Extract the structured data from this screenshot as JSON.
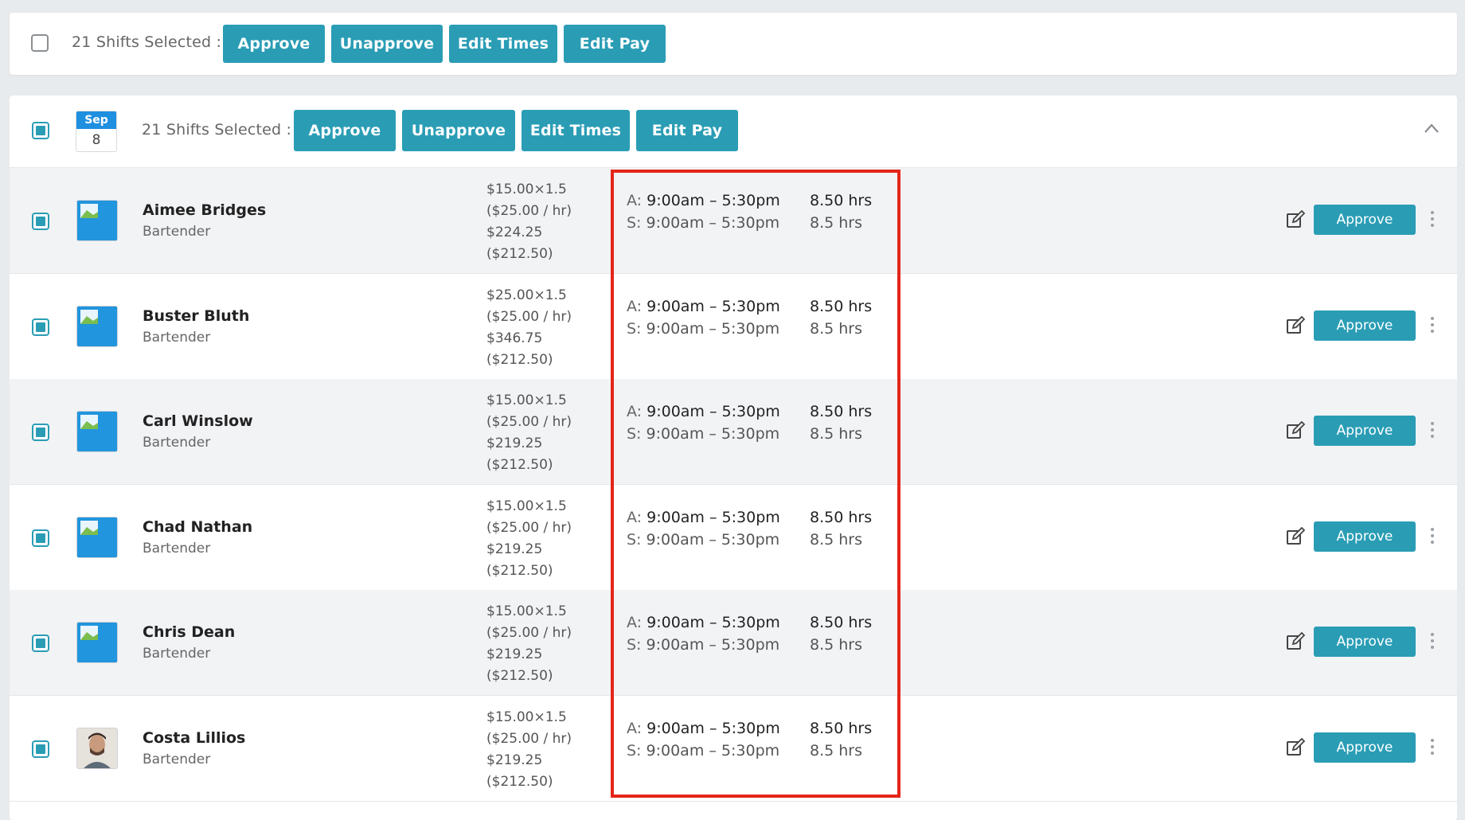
{
  "toolbar": {
    "selected_text": "21 Shifts Selected :",
    "approve": "Approve",
    "unapprove": "Unapprove",
    "edit_times": "Edit Times",
    "edit_pay": "Edit Pay"
  },
  "day_group": {
    "month": "Sep",
    "day": "8",
    "selected_text": "21 Shifts Selected :",
    "approve": "Approve",
    "unapprove": "Unapprove",
    "edit_times": "Edit Times",
    "edit_pay": "Edit Pay"
  },
  "shifts": [
    {
      "name": "Aimee Bridges",
      "role": "Bartender",
      "rate": "$15.00×1.5",
      "hourly": "($25.00 / hr)",
      "total": "$224.25",
      "base": "($212.50)",
      "a_label": "A:",
      "a_time": "9:00am – 5:30pm",
      "a_hrs": "8.50 hrs",
      "s_label": "S:",
      "s_time": "9:00am – 5:30pm",
      "s_hrs": "8.5 hrs",
      "approve": "Approve"
    },
    {
      "name": "Buster Bluth",
      "role": "Bartender",
      "rate": "$25.00×1.5",
      "hourly": "($25.00 / hr)",
      "total": "$346.75",
      "base": "($212.50)",
      "a_label": "A:",
      "a_time": "9:00am – 5:30pm",
      "a_hrs": "8.50 hrs",
      "s_label": "S:",
      "s_time": "9:00am – 5:30pm",
      "s_hrs": "8.5 hrs",
      "approve": "Approve"
    },
    {
      "name": "Carl Winslow",
      "role": "Bartender",
      "rate": "$15.00×1.5",
      "hourly": "($25.00 / hr)",
      "total": "$219.25",
      "base": "($212.50)",
      "a_label": "A:",
      "a_time": "9:00am – 5:30pm",
      "a_hrs": "8.50 hrs",
      "s_label": "S:",
      "s_time": "9:00am – 5:30pm",
      "s_hrs": "8.5 hrs",
      "approve": "Approve"
    },
    {
      "name": "Chad Nathan",
      "role": "Bartender",
      "rate": "$15.00×1.5",
      "hourly": "($25.00 / hr)",
      "total": "$219.25",
      "base": "($212.50)",
      "a_label": "A:",
      "a_time": "9:00am – 5:30pm",
      "a_hrs": "8.50 hrs",
      "s_label": "S:",
      "s_time": "9:00am – 5:30pm",
      "s_hrs": "8.5 hrs",
      "approve": "Approve"
    },
    {
      "name": "Chris Dean",
      "role": "Bartender",
      "rate": "$15.00×1.5",
      "hourly": "($25.00 / hr)",
      "total": "$219.25",
      "base": "($212.50)",
      "a_label": "A:",
      "a_time": "9:00am – 5:30pm",
      "a_hrs": "8.50 hrs",
      "s_label": "S:",
      "s_time": "9:00am – 5:30pm",
      "s_hrs": "8.5 hrs",
      "approve": "Approve"
    },
    {
      "name": "Costa Lillios",
      "role": "Bartender",
      "rate": "$15.00×1.5",
      "hourly": "($25.00 / hr)",
      "total": "$219.25",
      "base": "($212.50)",
      "a_label": "A:",
      "a_time": "9:00am – 5:30pm",
      "a_hrs": "8.50 hrs",
      "s_label": "S:",
      "s_time": "9:00am – 5:30pm",
      "s_hrs": "8.5 hrs",
      "approve": "Approve"
    }
  ],
  "colors": {
    "accent": "#2a9db5",
    "highlight": "#e4261a",
    "date_header": "#1f8fe0"
  },
  "icons": {
    "row_edit": "edit-square-icon",
    "row_menu": "kebab-menu-icon",
    "collapse": "chevron-up-icon",
    "avatar": "image-placeholder-icon"
  }
}
